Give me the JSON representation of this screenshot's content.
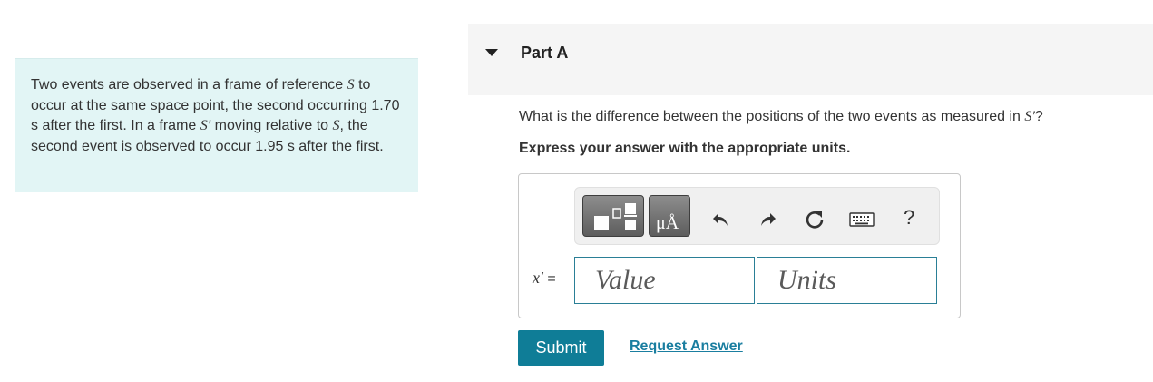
{
  "problem": {
    "text_1": "Two events are observed in a frame of reference ",
    "sym_s": "S",
    "text_2": " to occur at the same space point, the second occurring 1.70 s after the first. In a frame ",
    "sym_s_prime": "S′",
    "text_3": " moving relative to ",
    "sym_s2": "S",
    "text_4": ", the second event is observed to occur 1.95 s after the first."
  },
  "part": {
    "title": "Part A"
  },
  "question": {
    "text": "What is the difference between the positions of the two events as measured in ",
    "sym": "S′",
    "suffix": "?",
    "instruction": "Express your answer with the appropriate units."
  },
  "answer": {
    "variable": "x′",
    "equals": " =",
    "value_placeholder": "Value",
    "units_placeholder": "Units"
  },
  "toolbar": {
    "units_glyph": "μÅ",
    "help_label": "?",
    "icons": [
      "templates-icon",
      "units-icon",
      "undo-icon",
      "redo-icon",
      "reset-icon",
      "keyboard-icon",
      "help-icon"
    ]
  },
  "actions": {
    "submit_label": "Submit",
    "request_label": "Request Answer"
  },
  "colors": {
    "problem_bg": "#e2f5f5",
    "accent": "#0f7d97",
    "link": "#1a7ea0"
  }
}
